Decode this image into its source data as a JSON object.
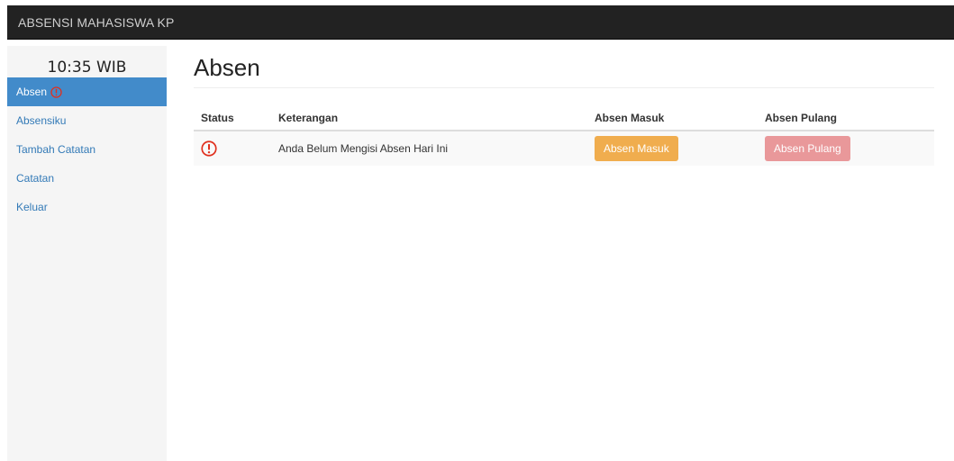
{
  "navbar": {
    "brand": "ABSENSI MAHASISWA KP"
  },
  "sidebar": {
    "clock": "10:35 WIB",
    "items": [
      {
        "label": "Absen",
        "active": true,
        "icon": "alert-circle-icon"
      },
      {
        "label": "Absensiku"
      },
      {
        "label": "Tambah Catatan"
      },
      {
        "label": "Catatan"
      },
      {
        "label": "Keluar"
      }
    ]
  },
  "main": {
    "title": "Absen",
    "table": {
      "headers": [
        "Status",
        "Keterangan",
        "Absen Masuk",
        "Absen Pulang"
      ],
      "rows": [
        {
          "status_icon": "alert-circle-icon",
          "keterangan": "Anda Belum Mengisi Absen Hari Ini",
          "masuk_button": "Absen Masuk",
          "pulang_button": "Absen Pulang"
        }
      ]
    }
  },
  "colors": {
    "navbar": "#222222",
    "active_nav": "#428bca",
    "link": "#337ab7",
    "warning": "#f0ad4e",
    "danger_muted": "#e9989a",
    "alert_icon": "#e0301e"
  }
}
